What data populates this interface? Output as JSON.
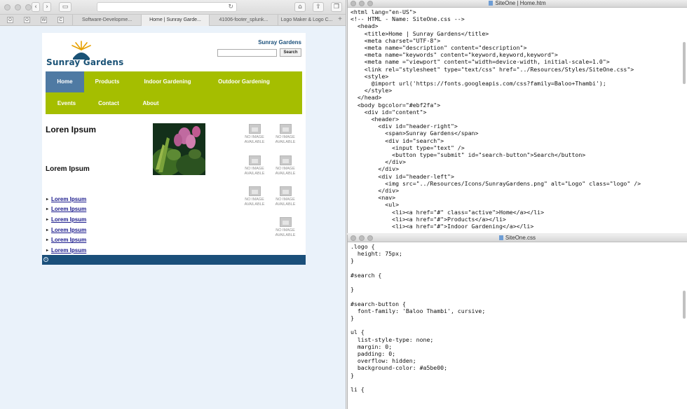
{
  "browser": {
    "tabs": [
      {
        "label": "Software-Developme..."
      },
      {
        "label": "Home | Sunray Garde..."
      },
      {
        "label": "41006-footer_splunk..."
      },
      {
        "label": "Logo Maker & Logo C..."
      }
    ],
    "favicons": [
      "O",
      "O",
      "W",
      "C"
    ]
  },
  "site": {
    "logo_text": "Sunray Gardens",
    "site_name": "Sunray Gardens",
    "search_button": "Search",
    "nav": [
      {
        "label": "Home"
      },
      {
        "label": "Products"
      },
      {
        "label": "Indoor Gardening"
      },
      {
        "label": "Outdoor Gardening"
      },
      {
        "label": "Events"
      },
      {
        "label": "Contact"
      },
      {
        "label": "About"
      }
    ],
    "heading_main": "Loren Ipsum",
    "heading_sub": "Lorem Ipsum",
    "links": [
      "Lorem Ipsum",
      "Lorem Ipsum",
      "Lorem Ipsum",
      "Lorem Ipsum",
      "Lorem Ipsum",
      "Lorem Ipsum"
    ],
    "no_image_text": "NO IMAGE AVAILABLE",
    "colors": {
      "nav": "#a5be00",
      "nav_active": "#4f7aa3",
      "footer": "#1a4f7a",
      "page_bg": "#eaf2fa"
    }
  },
  "editor_html": {
    "title": "SiteOne | Home.htm",
    "lines": [
      "<html lang=\"en-US\">",
      "<!-- HTML - Name: SiteOne.css -->",
      "  <head>",
      "    <title>Home | Sunray Gardens</title>",
      "    <meta charset=\"UTF-8\">",
      "    <meta name=\"description\" content=\"description\">",
      "    <meta name=\"keywords\" content=\"keyword,keyword,keyword\">",
      "    <meta name =\"viewport\" content=\"width=device-width, initial-scale=1.0\">",
      "    <link rel=\"stylesheet\" type=\"text/css\" href=\"../Resources/Styles/SiteOne.css\">",
      "    <style>",
      "      @import url('https://fonts.googleapis.com/css?family=Baloo+Thambi');",
      "    </style>",
      "  </head>",
      "  <body bgcolor=\"#ebf2fa\">",
      "    <div id=\"content\">",
      "      <header>",
      "        <div id=\"header-right\">",
      "          <span>Sunray Gardens</span>",
      "          <div id=\"search\">",
      "            <input type=\"text\" />",
      "            <button type=\"submit\" id=\"search-button\">Search</button>",
      "          </div>",
      "        </div>",
      "        <div id=\"header-left\">",
      "          <img src=\"../Resources/Icons/SunrayGardens.png\" alt=\"Logo\" class=\"logo\" />",
      "        </div>",
      "        <nav>",
      "          <ul>",
      "            <li><a href=\"#\" class=\"active\">Home</a></li>",
      "            <li><a href=\"#\">Products</a></li>",
      "            <li><a href=\"#\">Indoor Gardening</a></li>"
    ]
  },
  "editor_css": {
    "title": "SiteOne.css",
    "lines": [
      ".logo {",
      "  height: 75px;",
      "}",
      "",
      "#search {",
      "",
      "}",
      "",
      "#search-button {",
      "  font-family: 'Baloo Thambi', cursive;",
      "}",
      "",
      "ul {",
      "  list-style-type: none;",
      "  margin: 0;",
      "  padding: 0;",
      "  overflow: hidden;",
      "  background-color: #a5be00;",
      "}",
      "",
      "li {"
    ]
  }
}
